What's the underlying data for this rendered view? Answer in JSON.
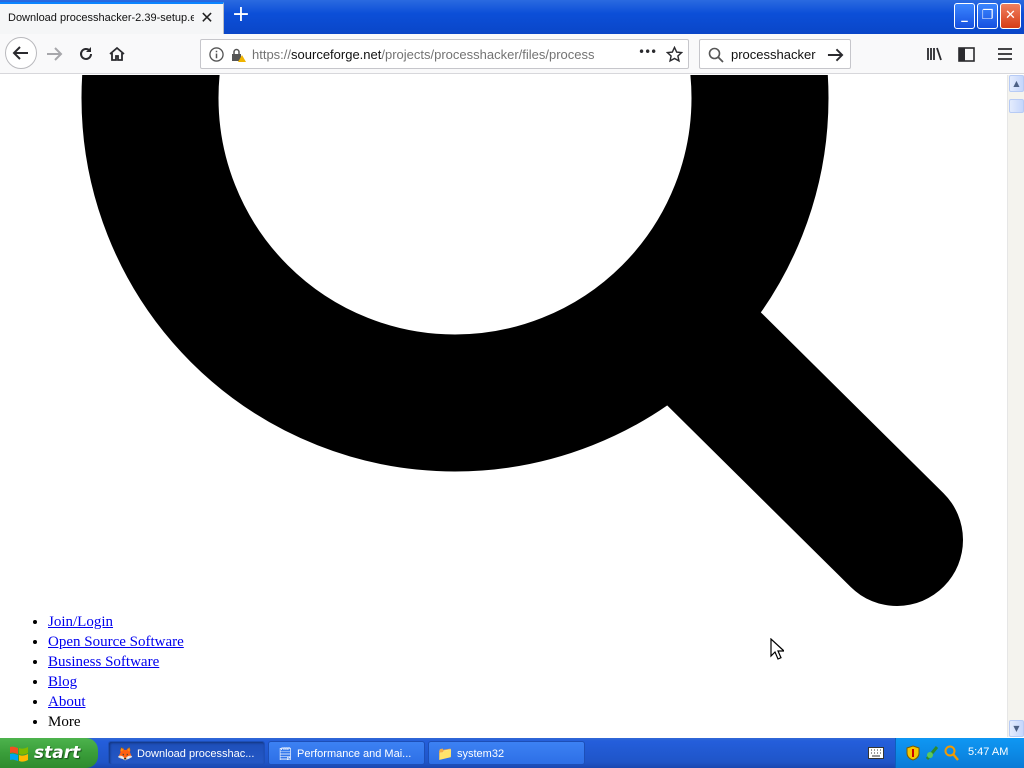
{
  "browser": {
    "tab_title": "Download processhacker-2.39-setup.e",
    "tab_close": "✕",
    "new_tab": "+",
    "url_prefix": "https://",
    "url_domain": "sourceforge.net",
    "url_path": "/projects/processhacker/files/process",
    "search_value": "processhacker",
    "page_actions": "•••"
  },
  "window_controls": {
    "minimize": "_",
    "restore": "❐",
    "close": "✕"
  },
  "page": {
    "menu": [
      {
        "label": "Join/Login",
        "link": true
      },
      {
        "label": "Open Source Software",
        "link": true
      },
      {
        "label": "Business Software",
        "link": true
      },
      {
        "label": "Blog",
        "link": true
      },
      {
        "label": "About",
        "link": true
      },
      {
        "label": "More",
        "link": false
      }
    ]
  },
  "taskbar": {
    "start_label": "start",
    "tasks": [
      {
        "label": "Download processhac...",
        "icon": "firefox-icon",
        "active": true
      },
      {
        "label": "Performance and Mai...",
        "icon": "control-panel-icon",
        "active": false
      },
      {
        "label": "system32",
        "icon": "folder-icon",
        "active": false
      }
    ],
    "clock": "5:47 AM"
  },
  "colors": {
    "link": "#0000ee",
    "taskbar": "#245edb",
    "start": "#3a9e3a",
    "tray": "#0c8ae6"
  }
}
